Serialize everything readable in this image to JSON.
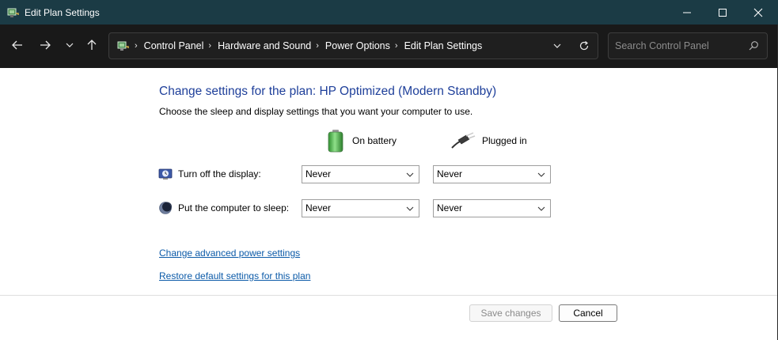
{
  "window": {
    "title": "Edit Plan Settings",
    "app_icon": "control-panel-power-icon"
  },
  "nav": {
    "breadcrumbs": [
      "Control Panel",
      "Hardware and Sound",
      "Power Options",
      "Edit Plan Settings"
    ],
    "search_placeholder": "Search Control Panel"
  },
  "content": {
    "heading": "Change settings for the plan: HP Optimized (Modern Standby)",
    "subtitle": "Choose the sleep and display settings that you want your computer to use.",
    "columns": {
      "battery": "On battery",
      "plugged": "Plugged in"
    },
    "rows": [
      {
        "label": "Turn off the display:",
        "battery": "Never",
        "plugged": "Never"
      },
      {
        "label": "Put the computer to sleep:",
        "battery": "Never",
        "plugged": "Never"
      }
    ],
    "links": {
      "advanced": "Change advanced power settings",
      "restore": "Restore default settings for this plan"
    }
  },
  "footer": {
    "save_label": "Save changes",
    "cancel_label": "Cancel"
  },
  "colors": {
    "titlebar": "#1b3b45",
    "navbar": "#191919",
    "heading": "#1e3f9a",
    "link": "#0b5aa8"
  }
}
